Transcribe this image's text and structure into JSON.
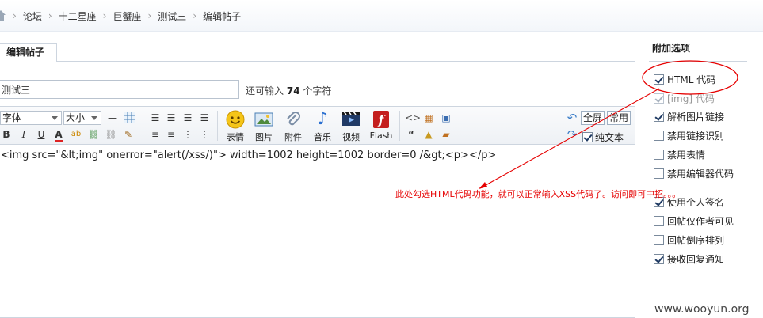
{
  "breadcrumb": {
    "items": [
      "论坛",
      "十二星座",
      "巨蟹座",
      "测试三",
      "编辑帖子"
    ],
    "separator": "›"
  },
  "editor": {
    "tab_label": "编辑帖子",
    "title_value": "测试三",
    "char_hint_prefix": "还可输入",
    "char_hint_count": "74",
    "char_hint_suffix": "个字符",
    "font_select": "字体",
    "size_select": "大小",
    "buttons": {
      "emoticon": "表情",
      "image": "图片",
      "attachment": "附件",
      "music": "音乐",
      "video": "视频",
      "flash": "Flash",
      "fullscreen": "全屏",
      "common": "常用",
      "plain_text": "纯文本"
    },
    "plain_text_checked": true,
    "content": "<img src=\"&lt;img\" onerror=\"alert(/xss/)\"> width=1002 height=1002 border=0 /&gt;<p></p>"
  },
  "sidebar": {
    "title": "附加选项",
    "options": [
      {
        "label": "HTML 代码",
        "checked": true,
        "disabled": false
      },
      {
        "label": "[img] 代码",
        "checked": true,
        "disabled": true
      },
      {
        "label": "解析图片链接",
        "checked": true,
        "disabled": false
      },
      {
        "label": "禁用链接识别",
        "checked": false,
        "disabled": false
      },
      {
        "label": "禁用表情",
        "checked": false,
        "disabled": false
      },
      {
        "label": "禁用编辑器代码",
        "checked": false,
        "disabled": false
      },
      {
        "label": "使用个人签名",
        "checked": true,
        "disabled": false
      },
      {
        "label": "回帖仅作者可见",
        "checked": false,
        "disabled": false
      },
      {
        "label": "回帖倒序排列",
        "checked": false,
        "disabled": false
      },
      {
        "label": "接收回复通知",
        "checked": true,
        "disabled": false
      }
    ]
  },
  "annotation": {
    "note": "此处勾选HTML代码功能，就可以正常输入XSS代码了。访问即可中招。。。",
    "color": "#e60000"
  },
  "watermark": "www.wooyun.org",
  "colors": {
    "accent": "#1f3a63",
    "border": "#cdd5df",
    "annotation": "#e60000"
  }
}
